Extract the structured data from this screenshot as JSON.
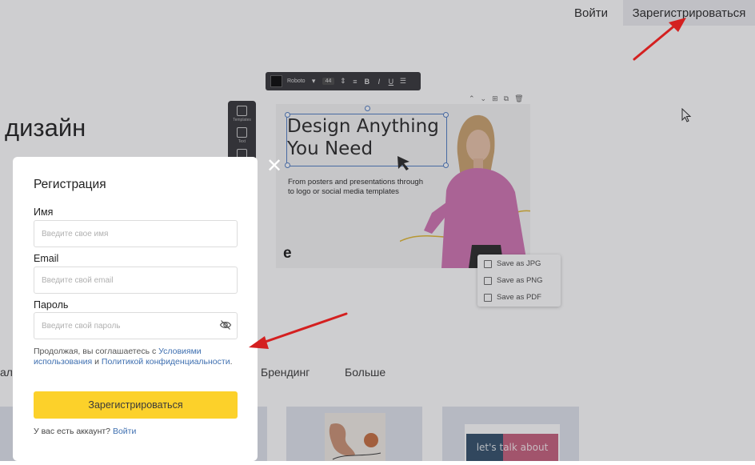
{
  "header": {
    "login_label": "Войти",
    "register_label": "Зарегистрироваться"
  },
  "hero": {
    "heading": "дизайн"
  },
  "editor": {
    "toolbar": {
      "font": "Roboto",
      "size": "44"
    },
    "rail": [
      {
        "label": "Templates"
      },
      {
        "label": "Text"
      }
    ],
    "design": {
      "title_line1": "Design Anything",
      "title_line2": "You Need",
      "subtitle": "From posters and presentations through to logo or social media templates",
      "logo": "e"
    },
    "export_menu": [
      {
        "label": "Save as JPG"
      },
      {
        "label": "Save as PNG"
      },
      {
        "label": "Save as PDF"
      }
    ]
  },
  "categories": {
    "partial_left": "ал",
    "branding": "Брендинг",
    "more": "Больше"
  },
  "cards": {
    "talk_text": "let's talk about"
  },
  "modal": {
    "title": "Регистрация",
    "name": {
      "label": "Имя",
      "placeholder": "Введите свое имя",
      "value": ""
    },
    "email": {
      "label": "Email",
      "placeholder": "Введите свой email",
      "value": ""
    },
    "password": {
      "label": "Пароль",
      "placeholder": "Введите свой пароль",
      "value": ""
    },
    "terms": {
      "prefix": "Продолжая, вы соглашаетесь с",
      "terms_link": "Условиями использования",
      "and": "и",
      "privacy_link": "Политикой конфиденциальности",
      "suffix": "."
    },
    "submit_label": "Зарегистрироваться",
    "footer": {
      "question": "У вас есть аккаунт?",
      "login_link": "Войти"
    }
  },
  "colors": {
    "accent_button": "#fcd12a",
    "link": "#3e6fb0",
    "annotation_arrow": "#d42020",
    "overlay": "rgba(65,65,75,0.26)",
    "selection": "#4a78c2"
  }
}
